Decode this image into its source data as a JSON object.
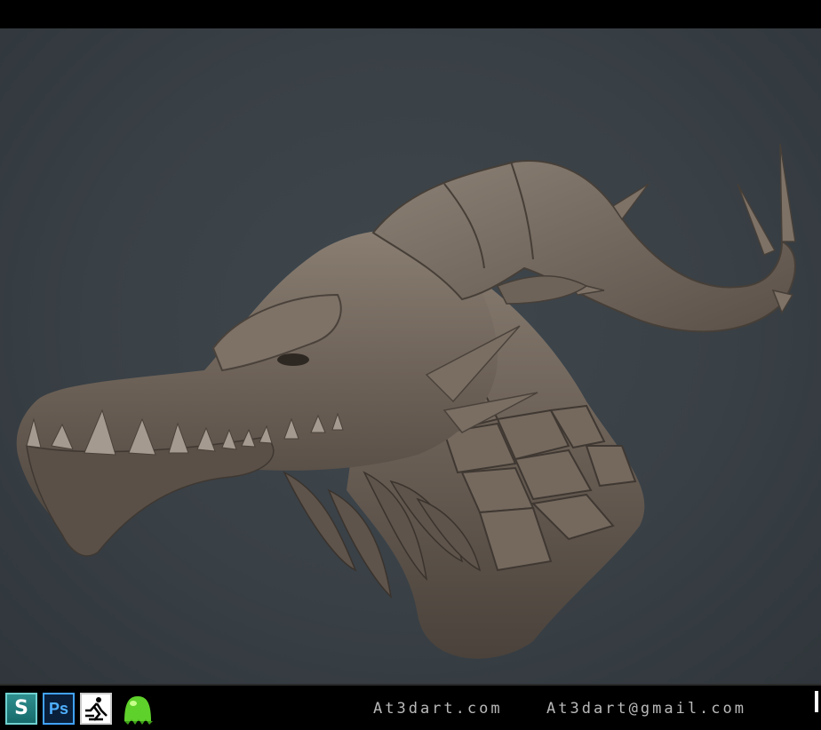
{
  "footer": {
    "website": "At3dart.com",
    "email": "At3dart@gmail.com",
    "tools": [
      {
        "name": "3ds Max",
        "icon": "3ds-max-icon",
        "glyph": "S"
      },
      {
        "name": "Photoshop",
        "icon": "photoshop-icon",
        "glyph": "Ps"
      },
      {
        "name": "ZBrush",
        "icon": "zbrush-icon"
      },
      {
        "name": "Substance",
        "icon": "substance-icon"
      }
    ]
  },
  "colors": {
    "background": "#394046",
    "sculpt": "#6a5f55",
    "sculpt_highlight": "#a3978a",
    "text": "#b9b9b9"
  }
}
